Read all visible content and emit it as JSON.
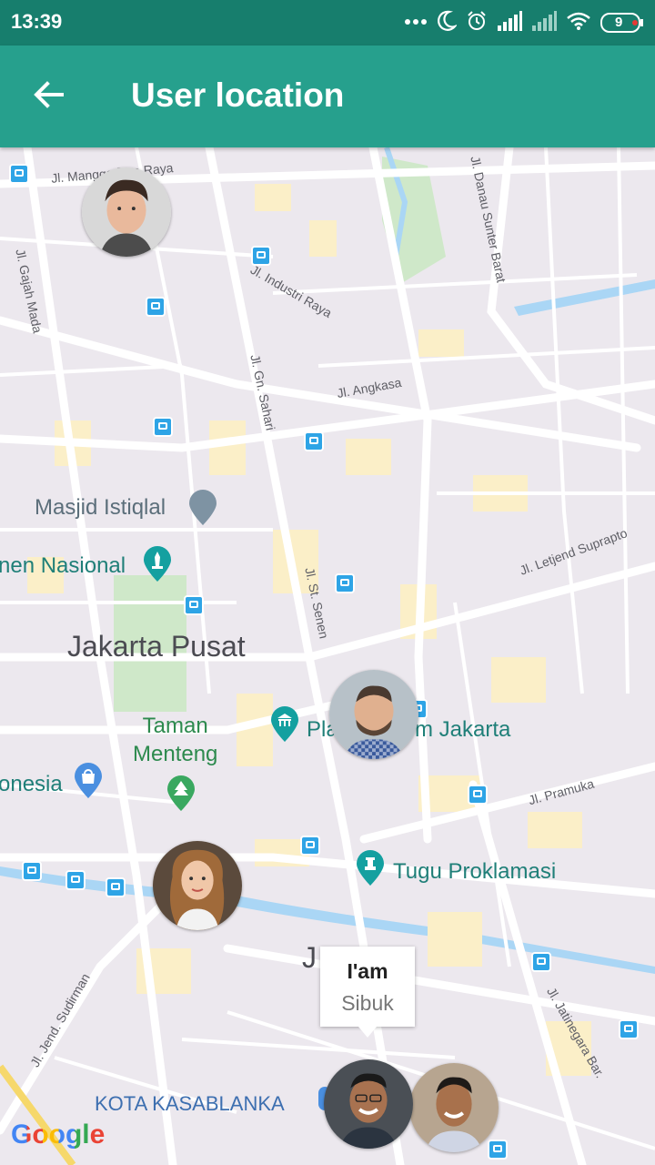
{
  "status_bar": {
    "time": "13:39",
    "battery": "9"
  },
  "app_bar": {
    "title": "User location"
  },
  "map": {
    "streets": [
      "Jl. Mangga Dua Raya",
      "Jl. Gajah Mada",
      "Jl. Industri Raya",
      "Jl. Danau Sunter Barat",
      "Jl. Gn. Sahari",
      "Jl. Angkasa",
      "Jl. St. Senen",
      "Jl. Letjend Suprapto",
      "Jl. Pramuka",
      "Jl. Jend. Sudirman",
      "Jl. Jatinegara Bar."
    ],
    "pois": {
      "masjid": "Masjid Istiqlal",
      "monumen": "nen Nasional",
      "district": "Jakarta Pusat",
      "taman": "Taman\nMenteng",
      "plaza_left": "Pla",
      "plaza_right": "m Jakarta",
      "indonesia": "onesia",
      "tugu": "Tugu Proklamasi",
      "j_partial": "J",
      "kota": "KOTA KASABLANKA"
    },
    "info_window": {
      "title": "I'am",
      "snippet": "Sibuk"
    },
    "attribution": "Google",
    "colors": {
      "accent": "#26a08d",
      "status_bar": "#177e6d",
      "transit": "#2ea4e6",
      "poi_green": "#3aa860"
    }
  }
}
